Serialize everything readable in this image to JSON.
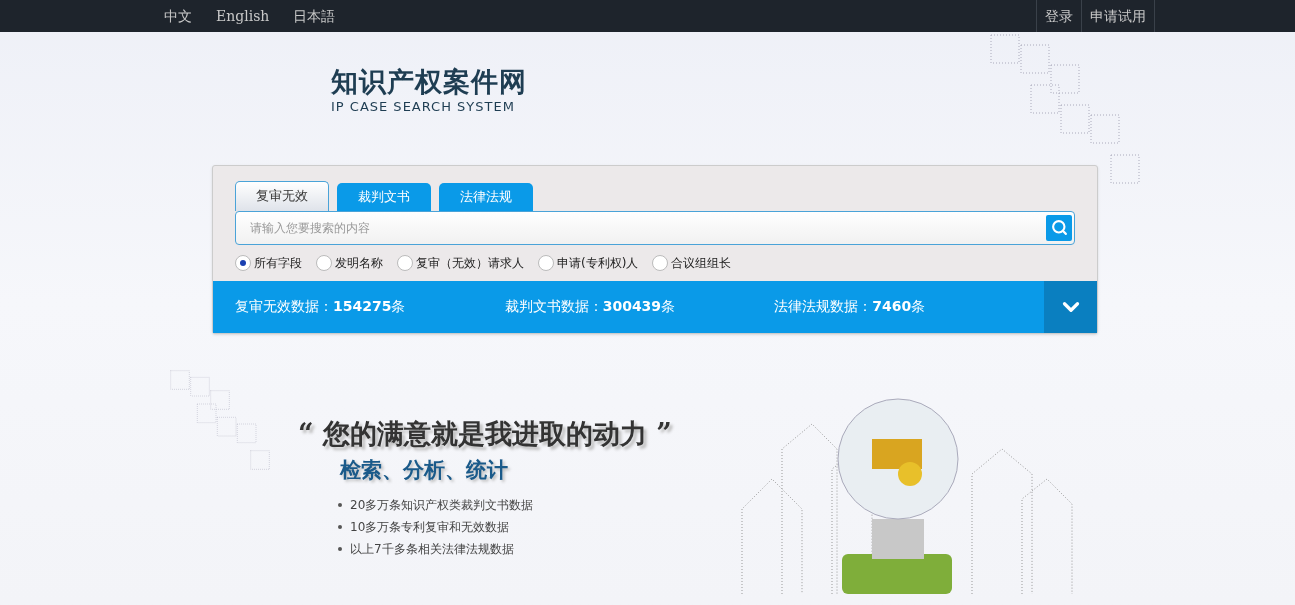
{
  "top_bar": {
    "languages": [
      "中文",
      "English",
      "日本語"
    ],
    "actions": [
      "登录",
      "申请试用"
    ]
  },
  "logo": {
    "title": "知识产权案件网",
    "subtitle": "IP CASE SEARCH SYSTEM"
  },
  "search": {
    "tabs": [
      {
        "label": "复审无效",
        "selected": true
      },
      {
        "label": "裁判文书",
        "selected": false
      },
      {
        "label": "法律法规",
        "selected": false
      }
    ],
    "placeholder": "请输入您要搜索的内容",
    "fields": [
      {
        "label": "所有字段",
        "selected": true
      },
      {
        "label": "发明名称",
        "selected": false
      },
      {
        "label": "复审（无效）请求人",
        "selected": false
      },
      {
        "label": "申请(专利权)人",
        "selected": false
      },
      {
        "label": "合议组组长",
        "selected": false
      }
    ]
  },
  "stats": [
    "复审无效数据：**154275**条",
    "裁判文书数据：**300439**条",
    "法律法规数据：**7460**条"
  ],
  "banner": {
    "slogan": "“ 您的满意就是我进取的动力 ”",
    "subtitle": "检索、分析、统计",
    "bullets": [
      "20多万条知识产权类裁判文书数据",
      "10多万条专利复审和无效数据",
      "以上7千多条相关法律法规数据"
    ]
  }
}
